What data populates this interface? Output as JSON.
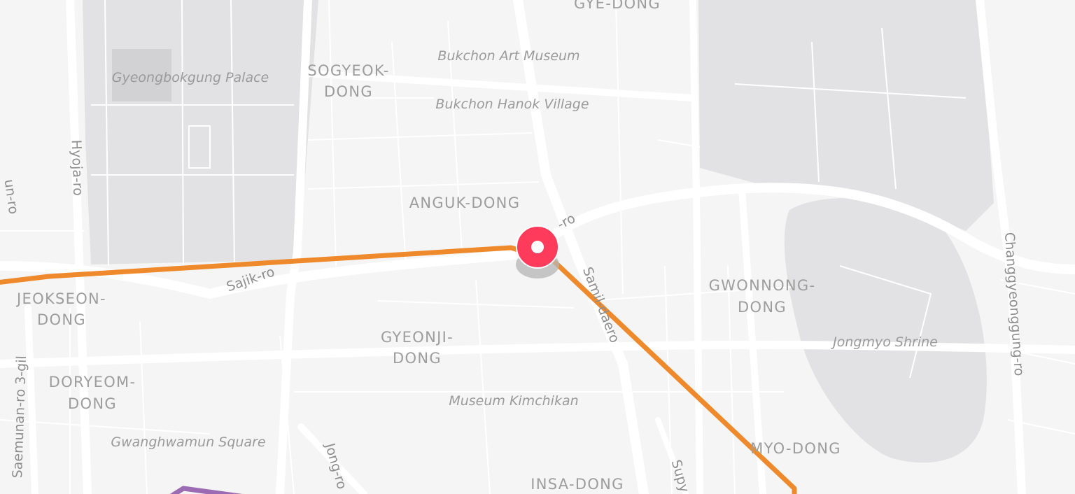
{
  "map": {
    "districts": [
      {
        "id": "gye-dong",
        "lines": [
          "GYE-DONG"
        ]
      },
      {
        "id": "sogyeok-dong",
        "lines": [
          "SOGYEOK-",
          "DONG"
        ]
      },
      {
        "id": "anguk-dong",
        "lines": [
          "ANGUK-DONG"
        ]
      },
      {
        "id": "jeokseon-dong",
        "lines": [
          "JEOKSEON-",
          "DONG"
        ]
      },
      {
        "id": "gyeonji-dong",
        "lines": [
          "GYEONJI-",
          "DONG"
        ]
      },
      {
        "id": "doryeom-dong",
        "lines": [
          "DORYEOM-",
          "DONG"
        ]
      },
      {
        "id": "gwonnong-dong",
        "lines": [
          "GWONNONG-",
          "DONG"
        ]
      },
      {
        "id": "myo-dong",
        "lines": [
          "MYO-DONG"
        ]
      },
      {
        "id": "insa-dong",
        "lines": [
          "INSA-DONG"
        ]
      }
    ],
    "pois": [
      {
        "id": "bukchon-art-museum",
        "label": "Bukchon Art Museum"
      },
      {
        "id": "gyeongbokgung-palace",
        "label": "Gyeongbokgung Palace"
      },
      {
        "id": "bukchon-hanok-village",
        "label": "Bukchon Hanok Village"
      },
      {
        "id": "jongmyo-shrine",
        "label": "Jongmyo Shrine"
      },
      {
        "id": "museum-kimchikan",
        "label": "Museum Kimchikan"
      },
      {
        "id": "gwanghwamun-square",
        "label": "Gwanghwamun Square"
      }
    ],
    "roads": [
      {
        "id": "hyoja-ro",
        "label": "Hyoja-ro"
      },
      {
        "id": "sajik-ro",
        "label": "Sajik-ro"
      },
      {
        "id": "samil-daero",
        "label": "Samil-daero"
      },
      {
        "id": "changgyeonggung-ro",
        "label": "Changgyeonggung-ro"
      },
      {
        "id": "saemunan-ro-3-gil",
        "label": "Saemunan-ro 3-gil"
      },
      {
        "id": "jong-ro",
        "label": "Jong-ro"
      },
      {
        "id": "yulgok-ro-partial",
        "label": "-ro"
      },
      {
        "id": "supyo-ro-partial",
        "label": "Supy"
      },
      {
        "id": "left-edge-road-partial",
        "label": "un-ro"
      }
    ],
    "routes": [
      {
        "id": "orange-route",
        "color": "#ef8a2c"
      },
      {
        "id": "purple-route",
        "color": "#9b6bb3"
      }
    ],
    "marker": {
      "id": "location-pin",
      "color": "#ff3b5c"
    },
    "colors": {
      "background": "#f5f5f6",
      "park": "#e2e2e4",
      "road": "#ffffff",
      "palace_building": "#cfcfd1"
    }
  }
}
